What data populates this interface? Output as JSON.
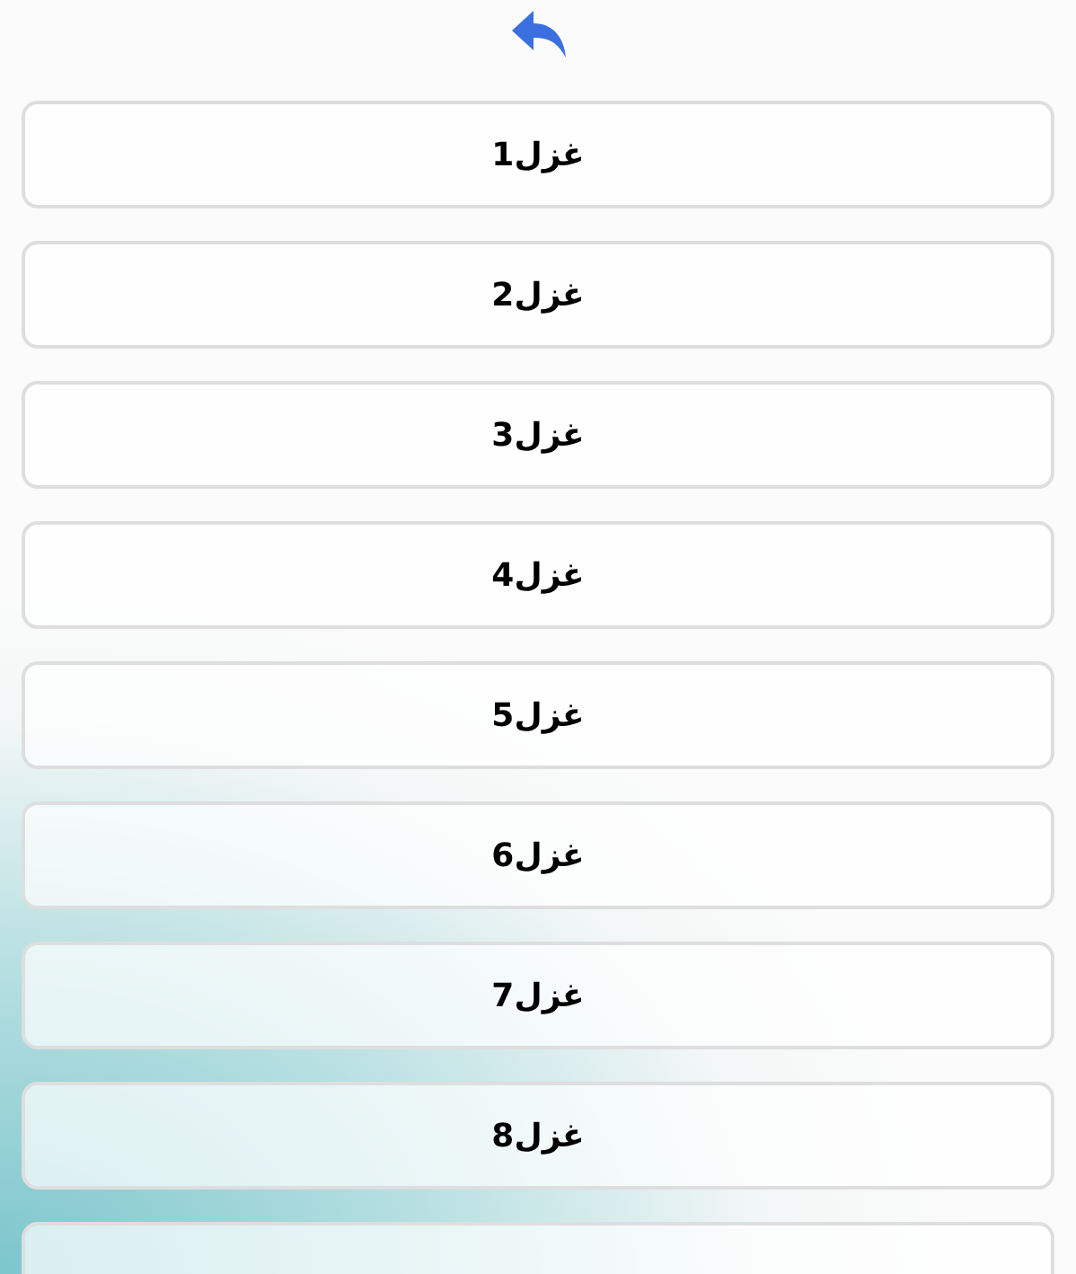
{
  "header": {
    "back": {
      "kind": "back"
    }
  },
  "items": [
    {
      "kind": "button",
      "label": "غزل1"
    },
    {
      "kind": "button",
      "label": "غزل2"
    },
    {
      "kind": "button",
      "label": "غزل3"
    },
    {
      "kind": "button",
      "label": "غزل4"
    },
    {
      "kind": "button",
      "label": "غزل5"
    },
    {
      "kind": "button",
      "label": "غزل6"
    },
    {
      "kind": "button",
      "label": "غزل7"
    },
    {
      "kind": "button",
      "label": "غزل8"
    },
    {
      "kind": "cut"
    }
  ]
}
